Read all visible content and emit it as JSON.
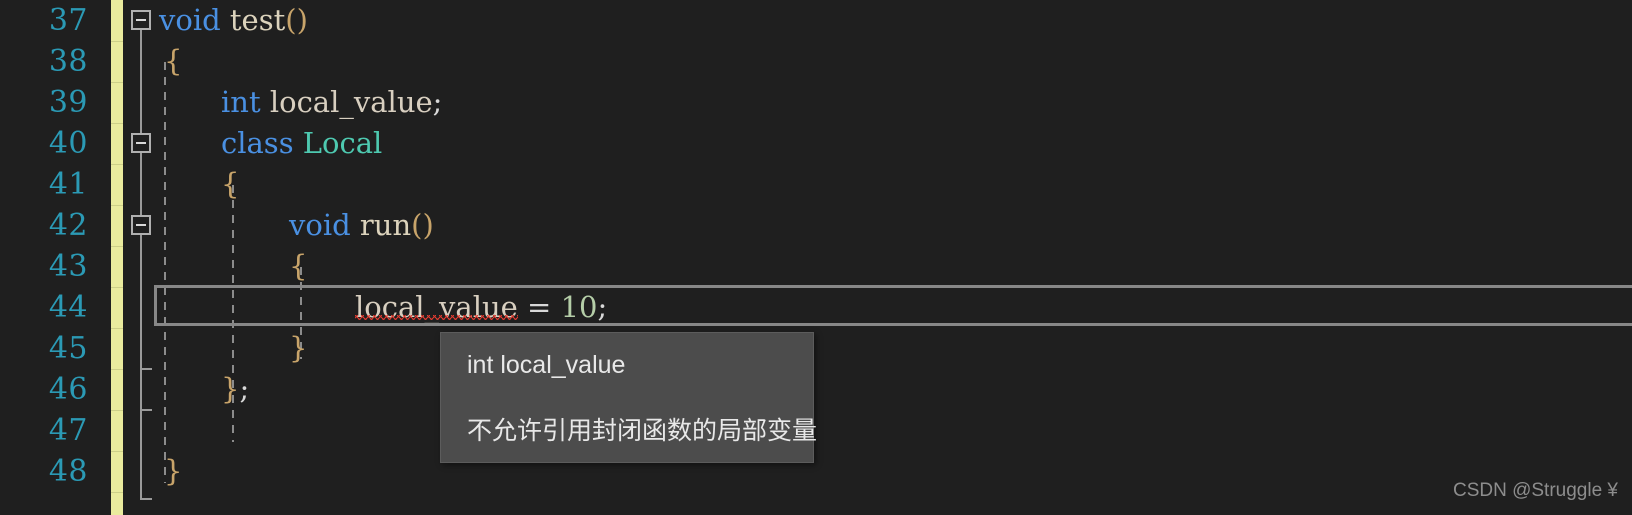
{
  "editor": {
    "theme_colors": {
      "background": "#1f1f1f",
      "line_number": "#2b9ab5",
      "keyword": "#4a90e2",
      "identifier": "#d8cfc0",
      "class_name": "#4ec9b0",
      "number_literal": "#b5cea8",
      "bracket": "#c8a46a",
      "change_bar": "#eaeb9e",
      "error_squiggle": "#e03b30",
      "current_line_border": "#878787",
      "tooltip_background": "#4c4c4c"
    },
    "first_line_number": 37,
    "current_line_number": 44,
    "lines": [
      {
        "number": "37",
        "fold": "open",
        "text": "void test()"
      },
      {
        "number": "38",
        "fold": "none",
        "text": "{"
      },
      {
        "number": "39",
        "fold": "none",
        "text": "    int local_value;"
      },
      {
        "number": "40",
        "fold": "open",
        "text": "    class Local"
      },
      {
        "number": "41",
        "fold": "none",
        "text": "    {"
      },
      {
        "number": "42",
        "fold": "open",
        "text": "        void run()"
      },
      {
        "number": "43",
        "fold": "none",
        "text": "        {"
      },
      {
        "number": "44",
        "fold": "none",
        "text": "            local_value = 10;"
      },
      {
        "number": "45",
        "fold": "none",
        "text": "        }"
      },
      {
        "number": "46",
        "fold": "end",
        "text": "    };"
      },
      {
        "number": "47",
        "fold": "end",
        "text": ""
      },
      {
        "number": "48",
        "fold": "none",
        "text": "}"
      }
    ],
    "tokens": {
      "line37": {
        "kw": "void",
        "fn": "test",
        "paren": "()"
      },
      "line39": {
        "kw": "int",
        "id": "local_value",
        "semi": ";"
      },
      "line40": {
        "kw": "class",
        "cls": "Local"
      },
      "line42": {
        "kw": "void",
        "fn": "run",
        "paren": "()"
      },
      "line44": {
        "id": "local_value",
        "op": "=",
        "num": "10",
        "semi": ";"
      }
    }
  },
  "tooltip": {
    "signature": "int local_value",
    "message": "不允许引用封闭函数的局部变量"
  },
  "watermark": {
    "text": "CSDN @Struggle ¥"
  }
}
